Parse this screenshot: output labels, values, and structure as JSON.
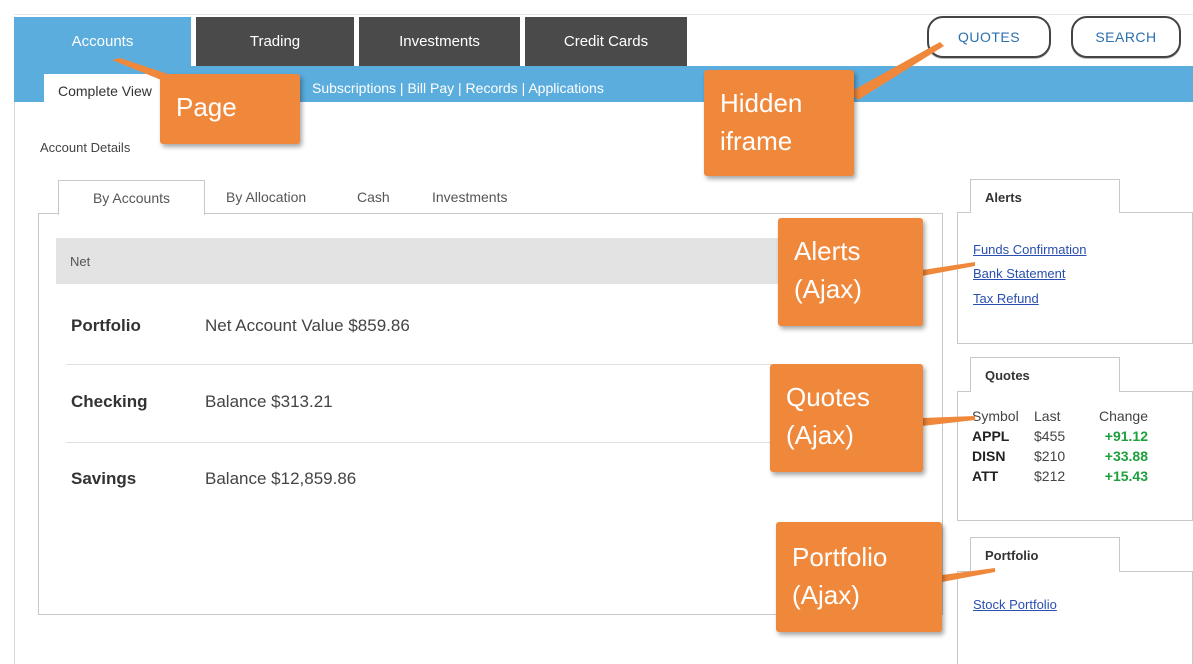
{
  "main_tabs": [
    "Accounts",
    "Trading",
    "Investments",
    "Credit Cards"
  ],
  "top_buttons": {
    "quotes": "QUOTES",
    "search": "SEARCH"
  },
  "subnav": {
    "first": "Complete View",
    "links": "Subscriptions | Bill Pay | Records | Applications"
  },
  "section_label": "Account Details",
  "content_tabs": [
    "By Accounts",
    "By Allocation",
    "Cash",
    "Investments"
  ],
  "net_label": "Net",
  "accounts": [
    {
      "name": "Portfolio",
      "value": "Net Account Value $859.86"
    },
    {
      "name": "Checking",
      "value": "Balance $313.21"
    },
    {
      "name": "Savings",
      "value": "Balance $12,859.86"
    }
  ],
  "alerts": {
    "title": "Alerts",
    "links": [
      "Funds Confirmation",
      "Bank Statement",
      "Tax Refund"
    ]
  },
  "quotes": {
    "title": "Quotes",
    "headers": [
      "Symbol",
      "Last",
      "Change"
    ],
    "rows": [
      {
        "symbol": "APPL",
        "last": "$455",
        "change": "+91.12"
      },
      {
        "symbol": "DISN",
        "last": "$210",
        "change": "+33.88"
      },
      {
        "symbol": "ATT",
        "last": "$212",
        "change": "+15.43"
      }
    ]
  },
  "portfolio": {
    "title": "Portfolio",
    "links": [
      "Stock Portfolio"
    ]
  },
  "callouts": {
    "page": "Page",
    "hidden_iframe": [
      "Hidden",
      "iframe"
    ],
    "alerts": [
      "Alerts",
      "(Ajax)"
    ],
    "quotes": [
      "Quotes",
      "(Ajax)"
    ],
    "portfolio": [
      "Portfolio",
      "(Ajax)"
    ]
  },
  "colors": {
    "tab_active": "#5badde",
    "tab_inactive": "#4a4a4a",
    "callout": "#f0883c",
    "positive_change": "#1ea03c",
    "link": "#2a4fb0"
  }
}
